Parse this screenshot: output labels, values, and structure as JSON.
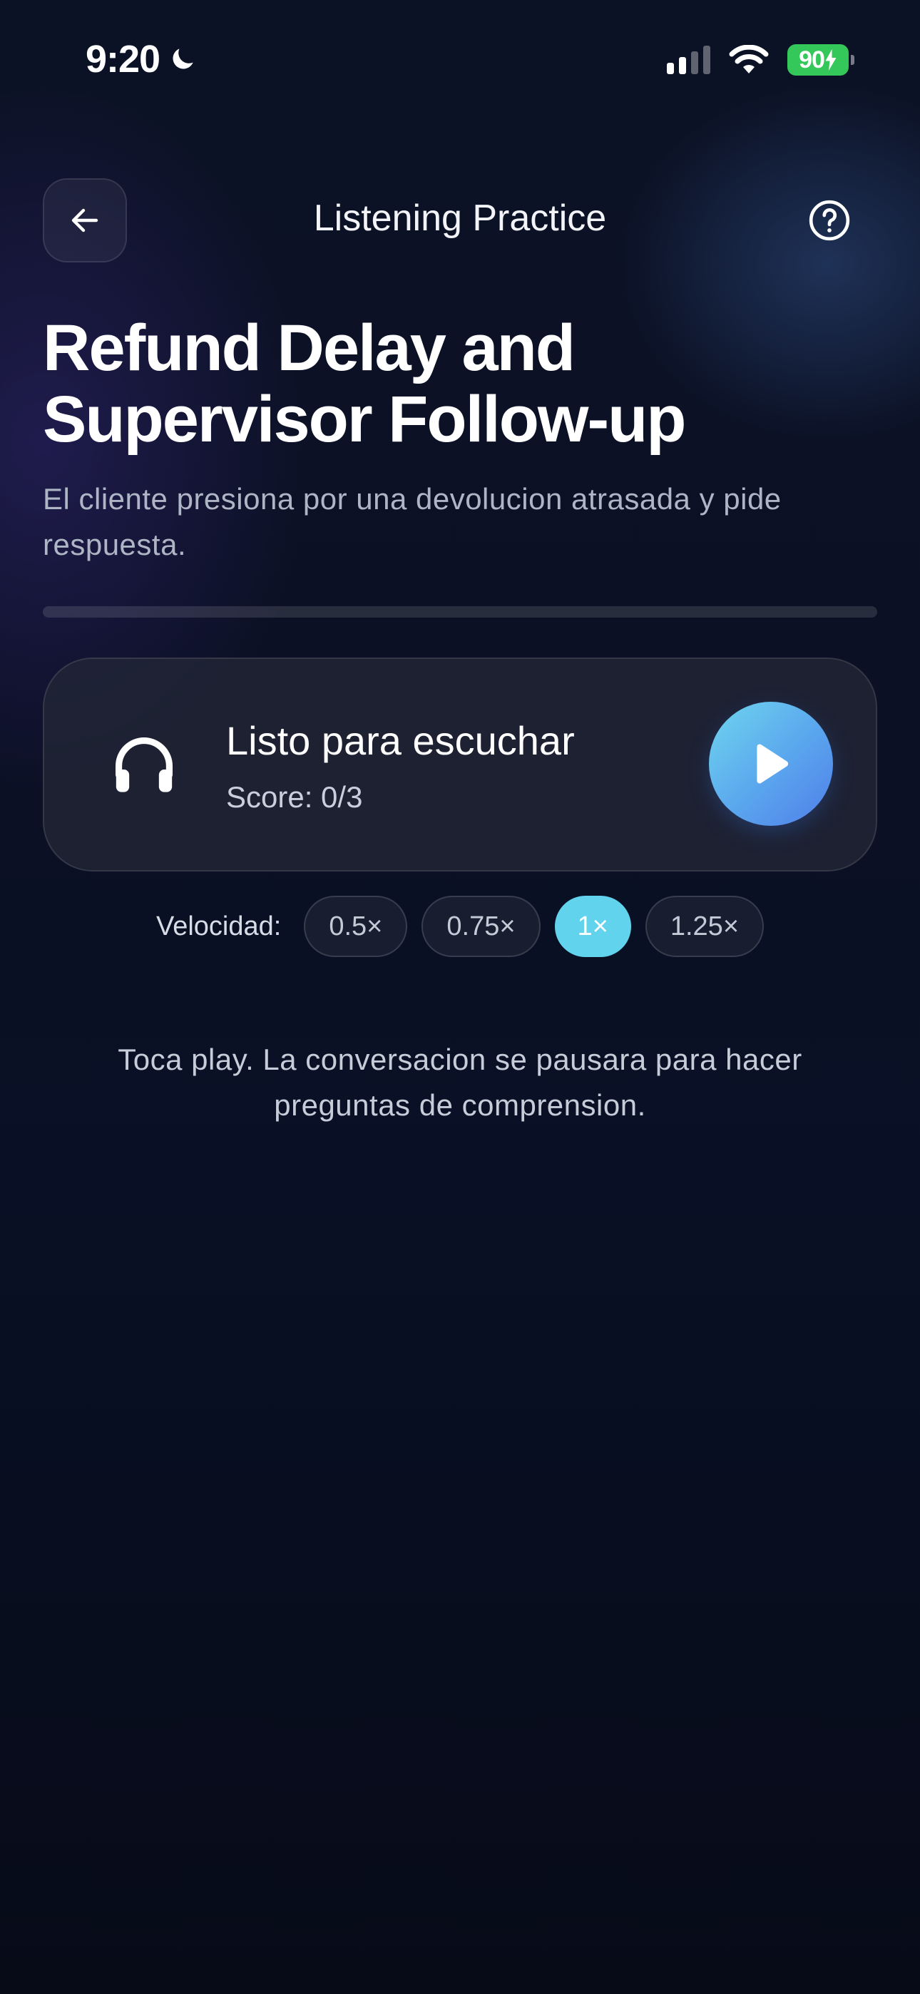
{
  "status_bar": {
    "time": "9:20",
    "battery": "90"
  },
  "nav": {
    "title": "Listening Practice"
  },
  "lesson": {
    "title": "Refund Delay and Supervisor Follow-up",
    "subtitle": "El cliente presiona por una devolucion atrasada y pide respuesta.",
    "progress": 0
  },
  "player": {
    "status": "Listo para escuchar",
    "score": "Score: 0/3"
  },
  "speed": {
    "label": "Velocidad:",
    "options": [
      "0.5×",
      "0.75×",
      "1×",
      "1.25×"
    ],
    "selected": "1×"
  },
  "hint": "Toca play. La conversacion se pausara para hacer preguntas de comprension.",
  "colors": {
    "accent": "#62d3ec",
    "battery": "#34c759",
    "background": "#0a0f1f"
  },
  "icons": {
    "back": "arrow-left-icon",
    "help": "question-circle-icon",
    "player": "headphones-icon",
    "play": "play-icon"
  }
}
